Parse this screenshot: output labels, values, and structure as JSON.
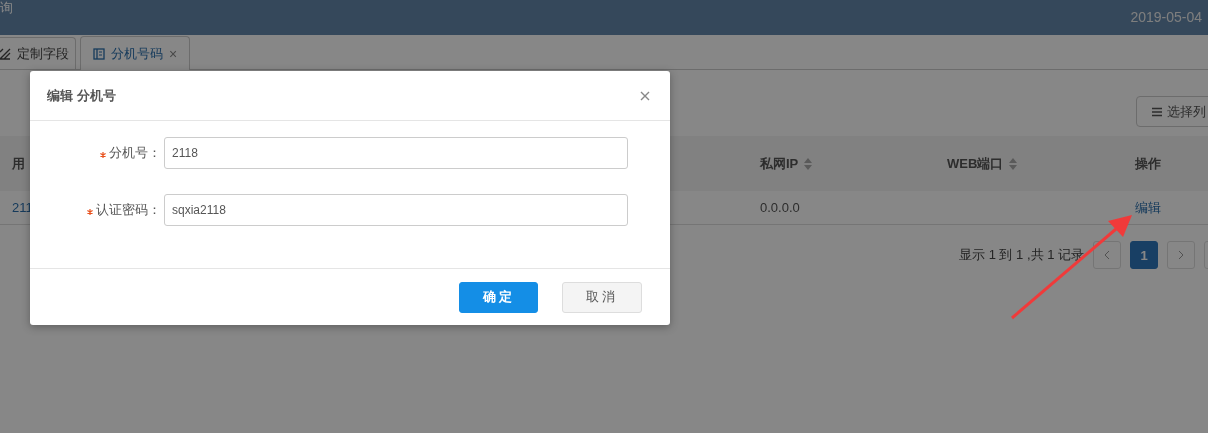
{
  "header": {
    "title": "询",
    "date": "2019-05-04"
  },
  "tabs": [
    {
      "label": "定制字段",
      "selected": false
    },
    {
      "label": "分机号码",
      "selected": true,
      "close": "×"
    }
  ],
  "toolbar": {
    "columns_button": "选择列"
  },
  "table": {
    "columns": [
      {
        "label": "用",
        "sortable": false
      },
      {
        "label": "私网IP",
        "sortable": true
      },
      {
        "label": "WEB端口",
        "sortable": true
      },
      {
        "label": "操作",
        "sortable": false
      }
    ],
    "rows": [
      {
        "user": "211",
        "private_ip": "0.0.0.0",
        "action": "编辑"
      }
    ]
  },
  "pagination": {
    "summary": "显示 1 到 1 ,共 1 记录",
    "pages": [
      {
        "label": "1",
        "selected": true
      }
    ]
  },
  "dialog": {
    "title": "编辑 分机号",
    "fields": [
      {
        "label": "分机号：",
        "required": true,
        "value": "2118"
      },
      {
        "label": "认证密码：",
        "required": true,
        "value": "sqxia2118"
      }
    ],
    "buttons": [
      {
        "label": "确定",
        "kind": "primary"
      },
      {
        "label": "取消",
        "kind": "default"
      }
    ]
  }
}
